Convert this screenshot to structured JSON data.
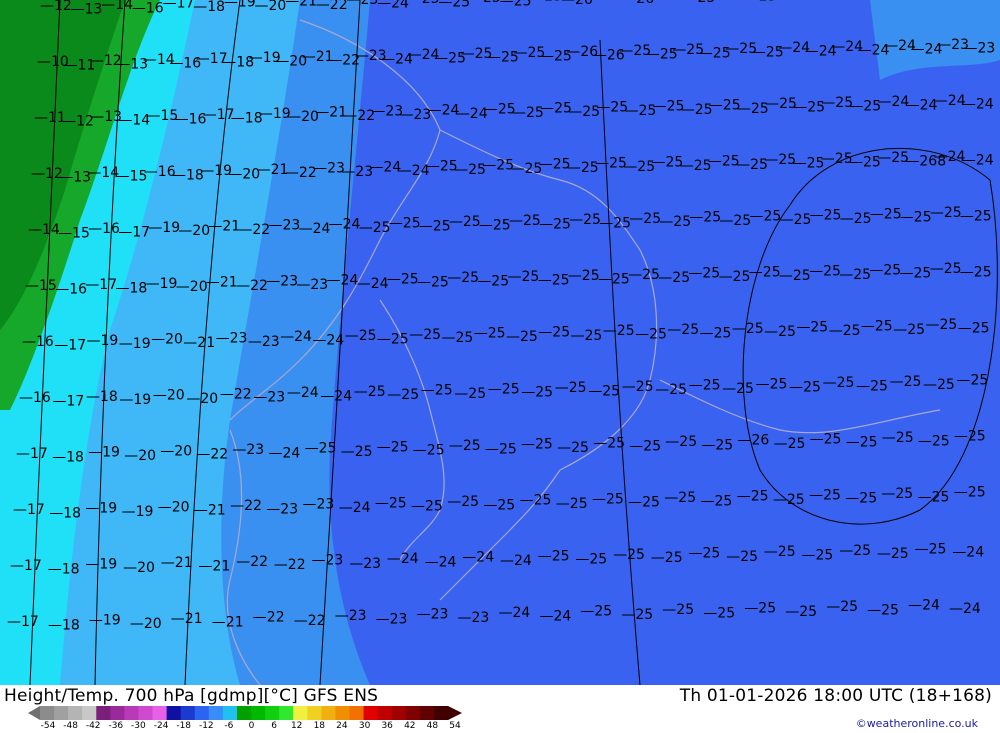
{
  "footer": {
    "title": "Height/Temp. 700 hPa [gdmp][°C] GFS ENS",
    "time": "Th 01-01-2026 18:00 UTC (18+168)",
    "credit": "©weatheronline.co.uk"
  },
  "legend": {
    "ticks": [
      "-54",
      "-48",
      "-42",
      "-36",
      "-30",
      "-24",
      "-18",
      "-12",
      "-6",
      "0",
      "6",
      "12",
      "18",
      "24",
      "30",
      "36",
      "42",
      "48",
      "54"
    ],
    "colors": [
      "#8c8c8c",
      "#a0a0a0",
      "#b4b4b4",
      "#c8c8c8",
      "#7a1f7a",
      "#9a2a9a",
      "#b83ab8",
      "#d04ad0",
      "#e860e8",
      "#1010a0",
      "#1a3ad0",
      "#2a64f0",
      "#3a8cf8",
      "#20c0f0",
      "#00a000",
      "#00b800",
      "#10d010",
      "#30e830",
      "#f0f040",
      "#f0d020",
      "#f0b010",
      "#f09000",
      "#f07000",
      "#e00000",
      "#c00000",
      "#a00000",
      "#800000",
      "#600000",
      "#400000"
    ]
  },
  "map": {
    "colors": {
      "green_dark": "#0a8a1a",
      "green": "#16a82a",
      "cyan": "#20e0f8",
      "sky": "#40b8f8",
      "light_blue": "#3a90f0",
      "blue": "#3a62f0",
      "coast": "#a8a8d0"
    },
    "contour_values": {
      "row_top": [
        "12",
        "13",
        "14",
        "16",
        "17",
        "18",
        "19",
        "20",
        "21",
        "22",
        "23",
        "24",
        "25",
        "25",
        "25",
        "25",
        "25",
        "26",
        "26",
        "26",
        "26",
        "25",
        "25",
        "25",
        "25",
        "24",
        "24",
        "24",
        "24",
        "23",
        "23"
      ],
      "row_2": [
        "10",
        "11",
        "12",
        "13",
        "14",
        "16",
        "17",
        "18",
        "19",
        "20",
        "21",
        "22",
        "23",
        "24",
        "24",
        "25",
        "25",
        "25",
        "25",
        "25",
        "26",
        "26",
        "25",
        "25",
        "25",
        "25",
        "25",
        "25",
        "24",
        "24",
        "24",
        "24",
        "24",
        "24",
        "23",
        "23"
      ],
      "row_3": [
        "11",
        "12",
        "13",
        "14",
        "15",
        "16",
        "17",
        "18",
        "19",
        "20",
        "21",
        "22",
        "23",
        "23",
        "24",
        "24",
        "25",
        "25",
        "25",
        "25",
        "25",
        "25",
        "25",
        "25",
        "25",
        "25",
        "25",
        "25",
        "25",
        "25",
        "24",
        "24",
        "24",
        "24"
      ],
      "row_4": [
        "12",
        "13",
        "14",
        "15",
        "16",
        "18",
        "19",
        "20",
        "21",
        "22",
        "23",
        "23",
        "24",
        "24",
        "25",
        "25",
        "25",
        "25",
        "25",
        "25",
        "25",
        "25",
        "25",
        "25",
        "25",
        "25",
        "25",
        "25",
        "25",
        "25",
        "25",
        "268",
        "24",
        "24"
      ],
      "row_5": [
        "14",
        "15",
        "16",
        "17",
        "19",
        "20",
        "21",
        "22",
        "23",
        "24",
        "24",
        "25",
        "25",
        "25",
        "25",
        "25",
        "25",
        "25",
        "25",
        "25",
        "25",
        "25",
        "25",
        "25",
        "25",
        "25",
        "25",
        "25",
        "25",
        "25",
        "25",
        "25"
      ],
      "row_6": [
        "15",
        "16",
        "17",
        "18",
        "19",
        "20",
        "21",
        "22",
        "23",
        "23",
        "24",
        "24",
        "25",
        "25",
        "25",
        "25",
        "25",
        "25",
        "25",
        "25",
        "25",
        "25",
        "25",
        "25",
        "25",
        "25",
        "25",
        "25",
        "25",
        "25",
        "25",
        "25"
      ],
      "row_7": [
        "16",
        "17",
        "19",
        "19",
        "20",
        "21",
        "23",
        "23",
        "24",
        "24",
        "25",
        "25",
        "25",
        "25",
        "25",
        "25",
        "25",
        "25",
        "25",
        "25",
        "25",
        "25",
        "25",
        "25",
        "25",
        "25",
        "25",
        "25",
        "25",
        "25"
      ],
      "row_8": [
        "16",
        "17",
        "18",
        "19",
        "20",
        "20",
        "22",
        "23",
        "24",
        "24",
        "25",
        "25",
        "25",
        "25",
        "25",
        "25",
        "25",
        "25",
        "25",
        "25",
        "25",
        "25",
        "25",
        "25",
        "25",
        "25",
        "25",
        "25",
        "25"
      ],
      "row_9": [
        "17",
        "18",
        "19",
        "20",
        "20",
        "22",
        "23",
        "24",
        "25",
        "25",
        "25",
        "25",
        "25",
        "25",
        "25",
        "25",
        "25",
        "25",
        "25",
        "25",
        "26",
        "25",
        "25",
        "25",
        "25",
        "25",
        "25"
      ],
      "row_10": [
        "17",
        "18",
        "19",
        "19",
        "20",
        "21",
        "22",
        "23",
        "23",
        "24",
        "25",
        "25",
        "25",
        "25",
        "25",
        "25",
        "25",
        "25",
        "25",
        "25",
        "25",
        "25",
        "25",
        "25",
        "25",
        "25",
        "25"
      ],
      "row_11": [
        "17",
        "18",
        "19",
        "20",
        "21",
        "21",
        "22",
        "22",
        "23",
        "23",
        "24",
        "24",
        "24",
        "24",
        "25",
        "25",
        "25",
        "25",
        "25",
        "25",
        "25",
        "25",
        "25",
        "25",
        "25",
        "24"
      ],
      "row_bottom": [
        "17",
        "18",
        "19",
        "20",
        "21",
        "21",
        "22",
        "22",
        "23",
        "23",
        "23",
        "23",
        "24",
        "24",
        "25",
        "25",
        "25",
        "25",
        "25",
        "25",
        "25",
        "25",
        "24",
        "24"
      ]
    }
  }
}
